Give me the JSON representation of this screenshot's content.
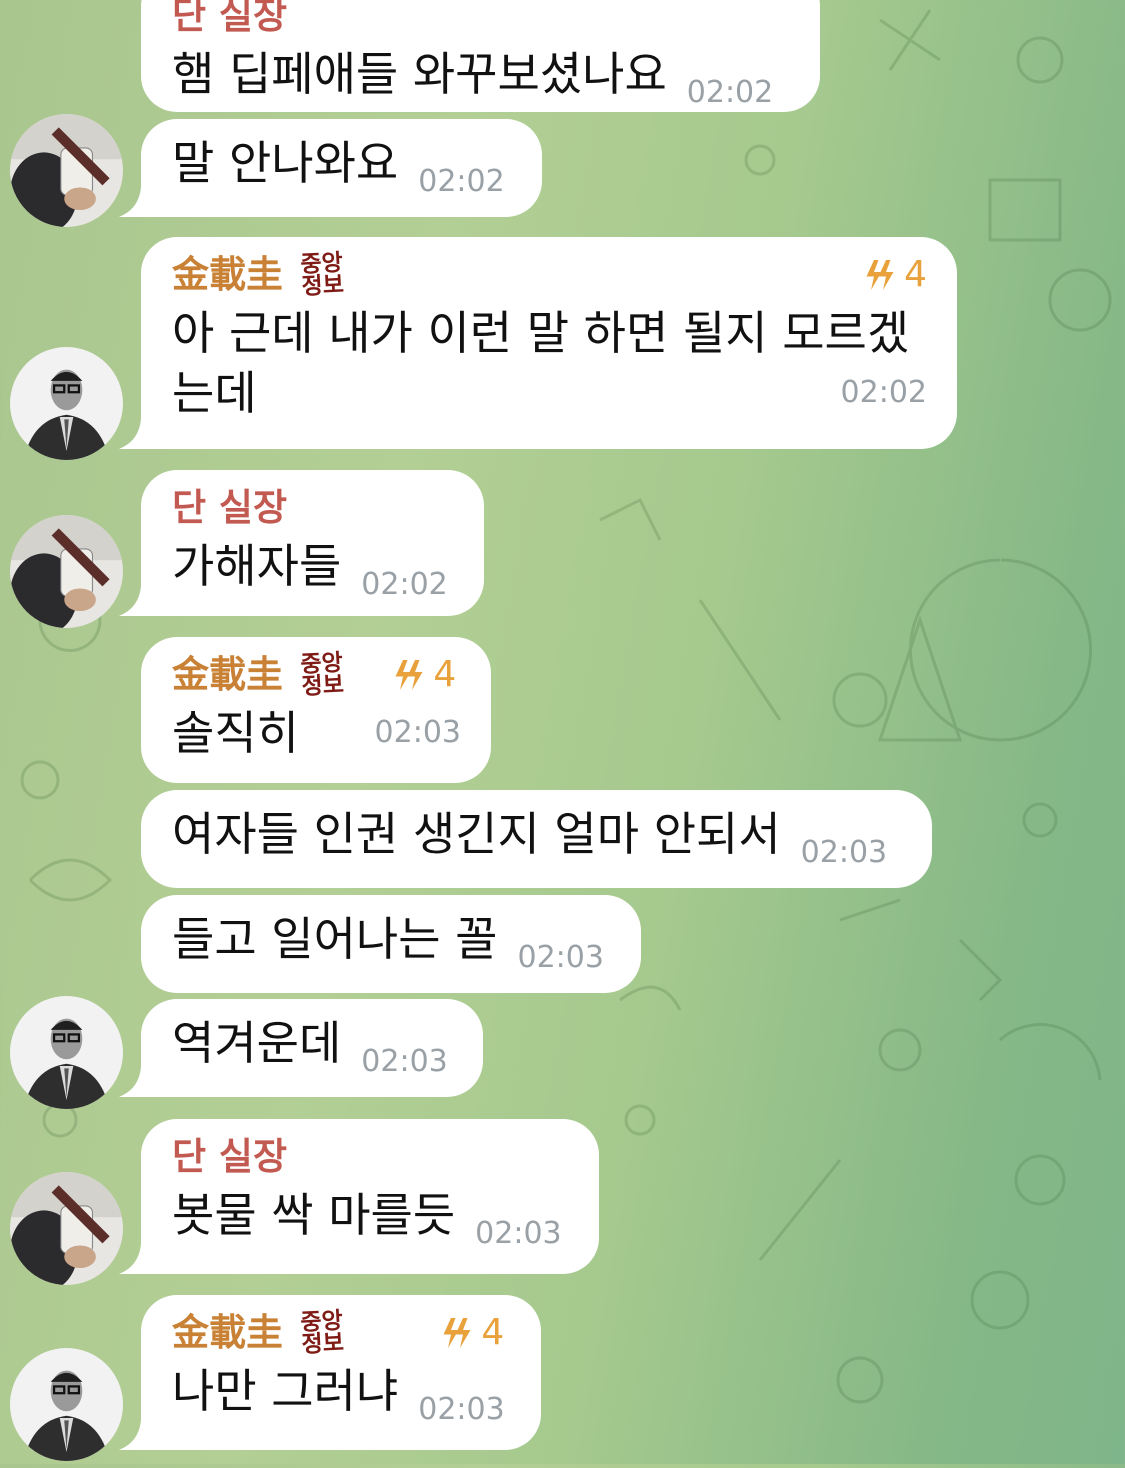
{
  "colors": {
    "bubble": "#ffffff",
    "sender_gold": "#c98135",
    "sender_red": "#c25a52",
    "time": "#9aa1a6",
    "boost": "#e9a13c"
  },
  "messages": [
    {
      "sender": "단 실장",
      "text": "햄 딥페애들 와꾸보셨나요",
      "time": "02:02"
    },
    {
      "text": "말 안나와요",
      "time": "02:02"
    },
    {
      "sender": "金載圭",
      "badge": [
        "중앙",
        "정보"
      ],
      "boost": "4",
      "text": "아 근데 내가 이런 말 하면 될지 모르겠",
      "text2": "는데",
      "time": "02:02"
    },
    {
      "sender": "단 실장",
      "text": "가해자들",
      "time": "02:02"
    },
    {
      "sender": "金載圭",
      "badge": [
        "중앙",
        "정보"
      ],
      "boost": "4",
      "text": "솔직히",
      "time": "02:03"
    },
    {
      "text": "여자들 인권 생긴지 얼마 안되서",
      "time": "02:03"
    },
    {
      "text": "들고 일어나는 꼴",
      "time": "02:03"
    },
    {
      "text": "역겨운데",
      "time": "02:03"
    },
    {
      "sender": "단 실장",
      "text": "봇물 싹 마를듯",
      "time": "02:03"
    },
    {
      "sender": "金載圭",
      "badge": [
        "중앙",
        "정보"
      ],
      "boost": "4",
      "text": "나만 그러냐",
      "time": "02:03"
    }
  ]
}
